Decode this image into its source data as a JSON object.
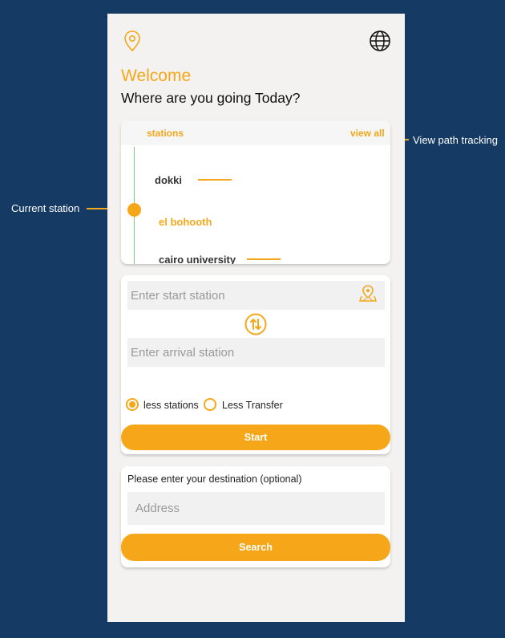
{
  "annotations": {
    "view_path": "View path tracking",
    "current_station": "Current station"
  },
  "header": {
    "welcome": "Welcome",
    "subtitle": "Where are you going Today?"
  },
  "stations": {
    "label": "stations",
    "view_all": "view all",
    "items": [
      {
        "name": "dokki",
        "current": false
      },
      {
        "name": "el bohooth",
        "current": true
      },
      {
        "name": "cairo university",
        "current": false
      }
    ]
  },
  "route_form": {
    "start_placeholder": "Enter start station",
    "arrival_placeholder": "Enter arrival station",
    "options": [
      {
        "label": "less stations",
        "selected": true
      },
      {
        "label": "Less Transfer",
        "selected": false
      }
    ],
    "start_button": "Start"
  },
  "destination": {
    "label": "Please enter your destination (optional)",
    "address_placeholder": "Address",
    "search_button": "Search"
  },
  "colors": {
    "accent": "#F5A719",
    "background": "#153A63",
    "track": "#7DCC84"
  },
  "icons": [
    "location-pin-icon",
    "globe-icon",
    "map-marker-icon",
    "swap-icon"
  ]
}
